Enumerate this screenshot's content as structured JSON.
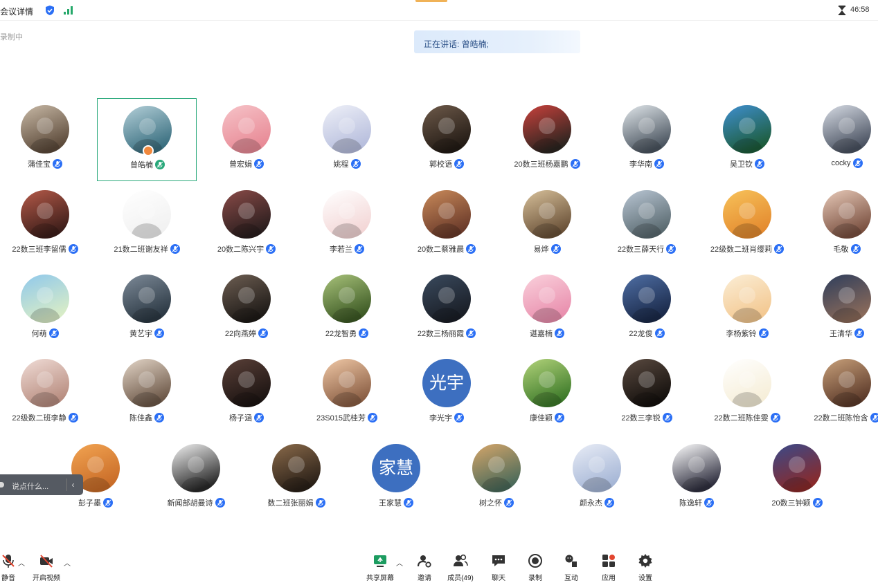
{
  "header": {
    "meeting_title": "会议详情",
    "timer": "46:58",
    "recording_status": "录制中"
  },
  "speaking": {
    "text": "正在讲话: 曾皓楠;"
  },
  "participants": [
    {
      "name": "蒲佳宝",
      "avatar": {
        "type": "photo",
        "c1": "#c8b9a6",
        "c2": "#5c4a3a"
      }
    },
    {
      "name": "曾皓楠",
      "avatar": {
        "type": "photo",
        "c1": "#b3cfd8",
        "c2": "#3a6f80"
      },
      "selected": true,
      "host": true
    },
    {
      "name": "曾宏娟",
      "avatar": {
        "type": "photo",
        "c1": "#f6c3c8",
        "c2": "#e88a96"
      }
    },
    {
      "name": "姚程",
      "avatar": {
        "type": "photo",
        "c1": "#eef0f8",
        "c2": "#b7bedd"
      }
    },
    {
      "name": "郭校语",
      "avatar": {
        "type": "photo",
        "c1": "#6e5a4a",
        "c2": "#231b15"
      }
    },
    {
      "name": "20数三班杨嘉鹏",
      "avatar": {
        "type": "photo",
        "c1": "#c9413c",
        "c2": "#2c2520"
      }
    },
    {
      "name": "李华南",
      "avatar": {
        "type": "photo",
        "c1": "#e0e6ea",
        "c2": "#4b5560"
      }
    },
    {
      "name": "吴卫钦",
      "avatar": {
        "type": "photo",
        "c1": "#3f8fd0",
        "c2": "#1d5c3a"
      }
    },
    {
      "name": "cocky",
      "avatar": {
        "type": "photo",
        "c1": "#d6dbe4",
        "c2": "#4a5261"
      }
    },
    {
      "name": "22数三班李留儒",
      "avatar": {
        "type": "photo",
        "c1": "#b55a49",
        "c2": "#3d1e1a"
      }
    },
    {
      "name": "21数二班谢友祥",
      "avatar": {
        "type": "photo",
        "c1": "#ffffff",
        "c2": "#f1f1f1"
      }
    },
    {
      "name": "20数二陈兴宇",
      "avatar": {
        "type": "photo",
        "c1": "#8a4b48",
        "c2": "#2a1e1e"
      }
    },
    {
      "name": "李若兰",
      "avatar": {
        "type": "photo",
        "c1": "#ffffff",
        "c2": "#f3d6d6"
      }
    },
    {
      "name": "20数二蔡雅晨",
      "avatar": {
        "type": "photo",
        "c1": "#c98a5a",
        "c2": "#6a3a2a"
      }
    },
    {
      "name": "易烨",
      "avatar": {
        "type": "photo",
        "c1": "#d7c09a",
        "c2": "#6a5138"
      }
    },
    {
      "name": "22数三薛天行",
      "avatar": {
        "type": "photo",
        "c1": "#b9c6d4",
        "c2": "#5a6a70"
      }
    },
    {
      "name": "22级数二班肖缨莉",
      "avatar": {
        "type": "photo",
        "c1": "#f7c25a",
        "c2": "#e48a2f"
      }
    },
    {
      "name": "毛敬",
      "avatar": {
        "type": "photo",
        "c1": "#e7c9b8",
        "c2": "#7a5040"
      }
    },
    {
      "name": "何萌",
      "avatar": {
        "type": "photo",
        "c1": "#8fc8ec",
        "c2": "#d8ecc7"
      }
    },
    {
      "name": "黄艺宇",
      "avatar": {
        "type": "photo",
        "c1": "#7d8a98",
        "c2": "#2c3944"
      }
    },
    {
      "name": "22向燕婷",
      "avatar": {
        "type": "photo",
        "c1": "#6d5e52",
        "c2": "#1e1a17"
      }
    },
    {
      "name": "22龙智勇",
      "avatar": {
        "type": "photo",
        "c1": "#a8c27a",
        "c2": "#3d5a25"
      }
    },
    {
      "name": "22数三杨丽霞",
      "avatar": {
        "type": "photo",
        "c1": "#3a4a5e",
        "c2": "#1a1e26"
      }
    },
    {
      "name": "谌嘉楠",
      "avatar": {
        "type": "photo",
        "c1": "#fad1dc",
        "c2": "#e98fae"
      }
    },
    {
      "name": "22龙俊",
      "avatar": {
        "type": "photo",
        "c1": "#4f6fa5",
        "c2": "#1b2a4a"
      }
    },
    {
      "name": "李杨紫铃",
      "avatar": {
        "type": "photo",
        "c1": "#fbeed6",
        "c2": "#f3c891"
      }
    },
    {
      "name": "王清华",
      "avatar": {
        "type": "photo",
        "c1": "#2e3e5c",
        "c2": "#8a6a5a"
      }
    },
    {
      "name": "22级数二班李静",
      "avatar": {
        "type": "photo",
        "c1": "#f0dcd6",
        "c2": "#b88d80"
      }
    },
    {
      "name": "陈佳鑫",
      "avatar": {
        "type": "photo",
        "c1": "#e3d5c7",
        "c2": "#6d5848"
      }
    },
    {
      "name": "杨子涵",
      "avatar": {
        "type": "photo",
        "c1": "#5a4038",
        "c2": "#1c1412"
      }
    },
    {
      "name": "23S015武桂芳",
      "avatar": {
        "type": "photo",
        "c1": "#f0c8a6",
        "c2": "#8a5e44"
      }
    },
    {
      "name": "李光宇",
      "avatar": {
        "type": "text",
        "text": "光宇",
        "color": "#3d6fc0"
      }
    },
    {
      "name": "康佳颖",
      "avatar": {
        "type": "photo",
        "c1": "#b2d37a",
        "c2": "#3d7a2a"
      }
    },
    {
      "name": "22数三李锐",
      "avatar": {
        "type": "photo",
        "c1": "#5a4a40",
        "c2": "#14100d"
      }
    },
    {
      "name": "22数二班陈佳雯",
      "avatar": {
        "type": "photo",
        "c1": "#ffffff",
        "c2": "#f6eed8"
      }
    },
    {
      "name": "22数二班陈怡含",
      "avatar": {
        "type": "photo",
        "c1": "#c8a07a",
        "c2": "#5c3a2a"
      }
    },
    {
      "name": "彭子墨",
      "avatar": {
        "type": "photo",
        "c1": "#f2a452",
        "c2": "#c96c28"
      }
    },
    {
      "name": "新闻部胡曼诗",
      "avatar": {
        "type": "photo",
        "c1": "#f2f2f2",
        "c2": "#2a2a2a"
      }
    },
    {
      "name": "数二班张丽娟",
      "avatar": {
        "type": "photo",
        "c1": "#8a6a4a",
        "c2": "#2a2018"
      }
    },
    {
      "name": "王家慧",
      "avatar": {
        "type": "text",
        "text": "家慧",
        "color": "#3d6fc0"
      }
    },
    {
      "name": "树之怀",
      "avatar": {
        "type": "photo",
        "c1": "#d6a66a",
        "c2": "#4a6a5a"
      }
    },
    {
      "name": "颜永杰",
      "avatar": {
        "type": "photo",
        "c1": "#e8ecf6",
        "c2": "#a5b6d6"
      }
    },
    {
      "name": "陈逸轩",
      "avatar": {
        "type": "photo",
        "c1": "#ffffff",
        "c2": "#303040"
      }
    },
    {
      "name": "20数三钟颖",
      "avatar": {
        "type": "photo",
        "c1": "#3a4a8a",
        "c2": "#8a2a2a"
      }
    }
  ],
  "chat": {
    "placeholder": "说点什么...",
    "collapse": "‹"
  },
  "toolbar": {
    "mute_label": "静音",
    "video_label": "开启视频",
    "share_label": "共享屏幕",
    "invite_label": "邀请",
    "members_label": "成员(49)",
    "chat_label": "聊天",
    "record_label": "录制",
    "react_label": "互动",
    "apps_label": "应用",
    "settings_label": "设置"
  },
  "colors": {
    "accent": "#2b6ff5",
    "selected_border": "#28a87a",
    "mute_red": "#e2452f",
    "host_badge": "#f0883d"
  }
}
